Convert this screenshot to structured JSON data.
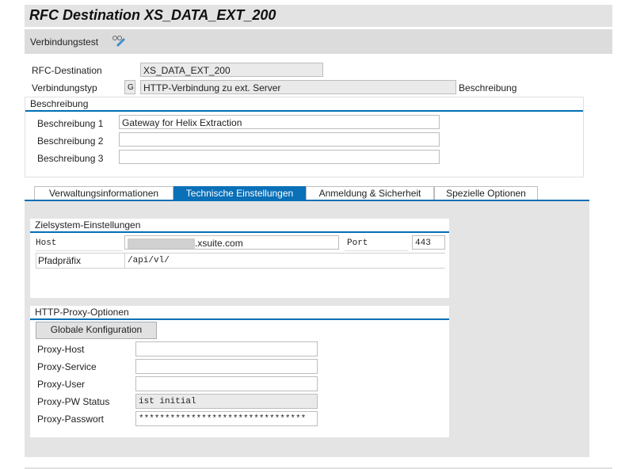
{
  "window": {
    "title": "RFC Destination XS_DATA_EXT_200"
  },
  "toolbar": {
    "connection_test": "Verbindungstest",
    "test_icon": "glasses-pencil-icon"
  },
  "header": {
    "rfc_destination_label": "RFC-Destination",
    "rfc_destination_value": "XS_DATA_EXT_200",
    "connection_type_label": "Verbindungstyp",
    "connection_type_code": "G",
    "connection_type_value": "HTTP-Verbindung zu ext. Server",
    "description_link": "Beschreibung"
  },
  "description": {
    "title": "Beschreibung",
    "rows": [
      {
        "label": "Beschreibung 1",
        "value": "Gateway for Helix Extraction"
      },
      {
        "label": "Beschreibung 2",
        "value": ""
      },
      {
        "label": "Beschreibung 3",
        "value": ""
      }
    ]
  },
  "tabs": [
    {
      "label": "Verwaltungsinformationen"
    },
    {
      "label": "Technische Einstellungen",
      "active": true
    },
    {
      "label": "Anmeldung & Sicherheit"
    },
    {
      "label": "Spezielle Optionen"
    }
  ],
  "target": {
    "title": "Zielsystem-Einstellungen",
    "host_label": "Host",
    "host_value": ".xsuite.com",
    "port_label": "Port",
    "port_value": "443",
    "path_label": "Pfadpräfix",
    "path_value": "/api/vl/"
  },
  "proxy": {
    "title": "HTTP-Proxy-Optionen",
    "global_button": "Globale Konfiguration",
    "rows": [
      {
        "label": "Proxy-Host",
        "value": ""
      },
      {
        "label": "Proxy-Service",
        "value": ""
      },
      {
        "label": "Proxy-User",
        "value": ""
      },
      {
        "label": "Proxy-PW Status",
        "value": "ist initial"
      },
      {
        "label": "Proxy-Passwort",
        "value": "********************************"
      }
    ]
  },
  "colors": {
    "accent": "#0a70b8"
  }
}
